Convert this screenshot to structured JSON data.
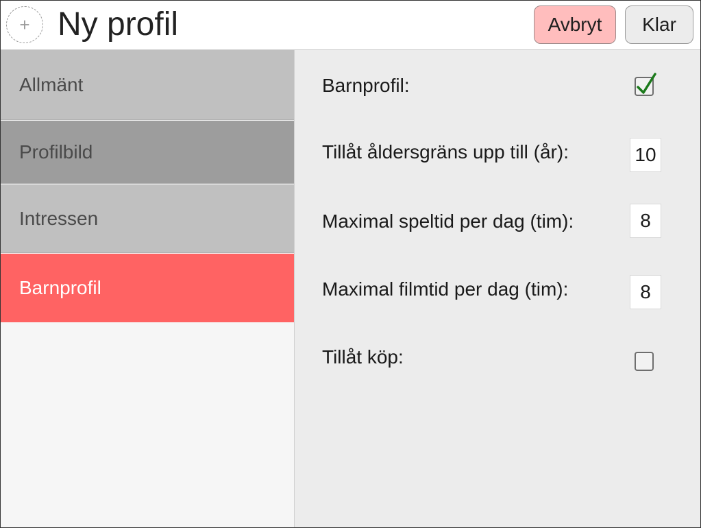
{
  "header": {
    "avatar_symbol": "+",
    "title": "Ny profil",
    "cancel_label": "Avbryt",
    "done_label": "Klar"
  },
  "sidebar": {
    "items": [
      {
        "label": "Allmänt"
      },
      {
        "label": "Profilbild"
      },
      {
        "label": "Intressen"
      },
      {
        "label": "Barnprofil",
        "selected": true
      }
    ]
  },
  "form": {
    "child_profile": {
      "label": "Barnprofil:",
      "checked": true
    },
    "age_limit": {
      "label": "Tillåt åldersgräns upp till (år):",
      "value": "10"
    },
    "max_game_time": {
      "label": "Maximal speltid per dag (tim):",
      "value": "8"
    },
    "max_movie_time": {
      "label": "Maximal filmtid per dag (tim):",
      "value": "8"
    },
    "allow_purchases": {
      "label": "Tillåt köp:",
      "checked": false
    }
  },
  "colors": {
    "selected_item": "#ff6363",
    "cancel_button": "#ffbdbd",
    "checkmark": "#1b7a1b"
  },
  "icons": {
    "avatar": "plus-icon",
    "checkmark": "checkmark-icon"
  }
}
